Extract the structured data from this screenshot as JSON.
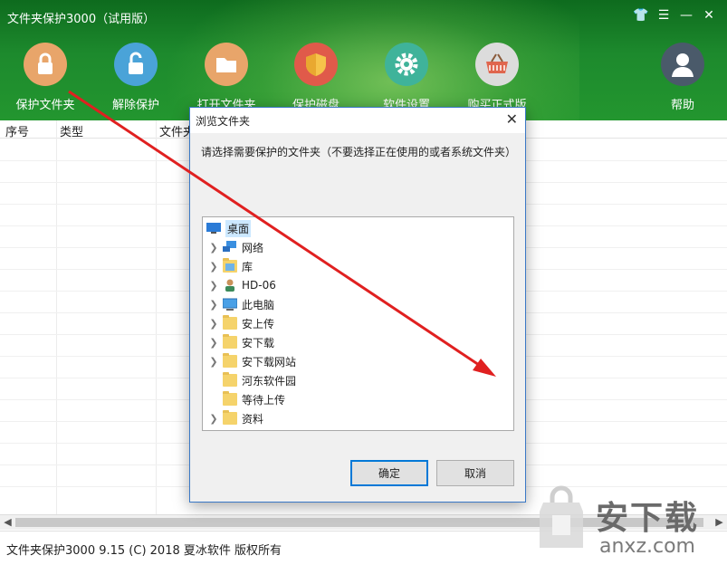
{
  "app": {
    "title": "文件夹保护3000（试用版）",
    "controls": {
      "skin": "👕",
      "menu": "☰",
      "minimize": "—",
      "close": "✕"
    }
  },
  "toolbar": [
    {
      "label": "保护文件夹",
      "icon": "lock-closed-icon",
      "color": "#e8a56a"
    },
    {
      "label": "解除保护",
      "icon": "lock-open-icon",
      "color": "#4aa3d8"
    },
    {
      "label": "打开文件夹",
      "icon": "folder-icon",
      "color": "#e8a56a"
    },
    {
      "label": "保护磁盘",
      "icon": "shield-icon",
      "color": "#e05a4a"
    },
    {
      "label": "软件设置",
      "icon": "gear-icon",
      "color": "#3fb39a"
    },
    {
      "label": "购买正式版",
      "icon": "basket-icon",
      "color": "#dcdcdc"
    },
    {
      "label": "帮助",
      "icon": "user-icon",
      "color": "#4a5a6a"
    }
  ],
  "table": {
    "columns": [
      "序号",
      "类型",
      "文件夹"
    ]
  },
  "status_text": "文件夹保护3000 9.15 (C) 2018 夏冰软件 版权所有",
  "dialog": {
    "title": "浏览文件夹",
    "close": "✕",
    "description": "请选择需要保护的文件夹（不要选择正在使用的或者系统文件夹）",
    "tree": [
      {
        "label": "桌面",
        "icon": "desktop-icon",
        "expandable": false,
        "selected": true,
        "level": 0
      },
      {
        "label": "网络",
        "icon": "network-icon",
        "expandable": true,
        "level": 1
      },
      {
        "label": "库",
        "icon": "library-icon",
        "expandable": true,
        "level": 1
      },
      {
        "label": "HD-06",
        "icon": "user-icon",
        "expandable": true,
        "level": 1
      },
      {
        "label": "此电脑",
        "icon": "computer-icon",
        "expandable": true,
        "level": 1
      },
      {
        "label": "安上传",
        "icon": "folder-icon",
        "expandable": true,
        "level": 1
      },
      {
        "label": "安下载",
        "icon": "folder-icon",
        "expandable": true,
        "level": 1
      },
      {
        "label": "安下载网站",
        "icon": "folder-icon",
        "expandable": true,
        "level": 1
      },
      {
        "label": "河东软件园",
        "icon": "folder-icon",
        "expandable": false,
        "level": 1
      },
      {
        "label": "等待上传",
        "icon": "folder-icon",
        "expandable": false,
        "level": 1
      },
      {
        "label": "资料",
        "icon": "folder-icon",
        "expandable": true,
        "level": 1
      }
    ],
    "ok_label": "确定",
    "cancel_label": "取消"
  },
  "watermark": {
    "main": "安下载",
    "site": "anxz.com"
  }
}
